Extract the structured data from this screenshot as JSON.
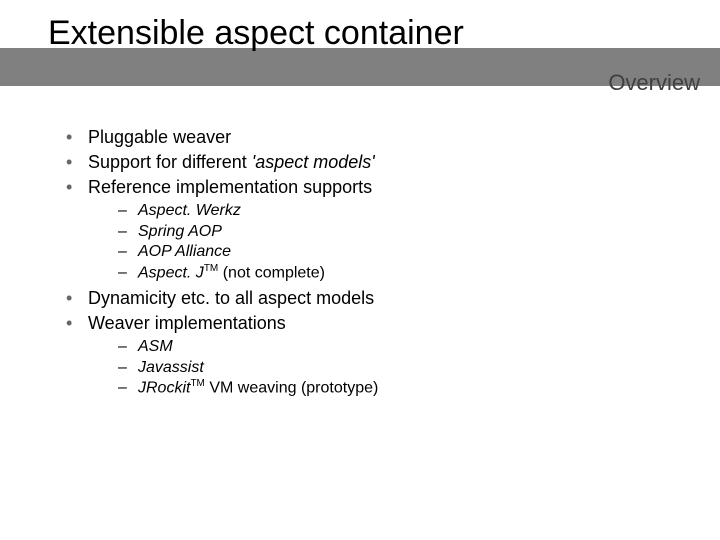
{
  "title": "Extensible aspect container",
  "section_label": "Overview",
  "bullets": {
    "b0": "Pluggable weaver",
    "b1_pre": "Support for different ",
    "b1_em": "'aspect models'",
    "b2": "Reference implementation supports",
    "b2_sub": {
      "s0": "Aspect. Werkz",
      "s1": "Spring AOP",
      "s2": "AOP Alliance",
      "s3_pre": "Aspect. J",
      "s3_tm": "TM",
      "s3_post": " (not complete)"
    },
    "b3": "Dynamicity etc. to all aspect models",
    "b4": "Weaver implementations",
    "b4_sub": {
      "s0": "ASM",
      "s1": "Javassist",
      "s2_pre": "JRockit",
      "s2_tm": "TM",
      "s2_post": " VM weaving (prototype)"
    }
  }
}
